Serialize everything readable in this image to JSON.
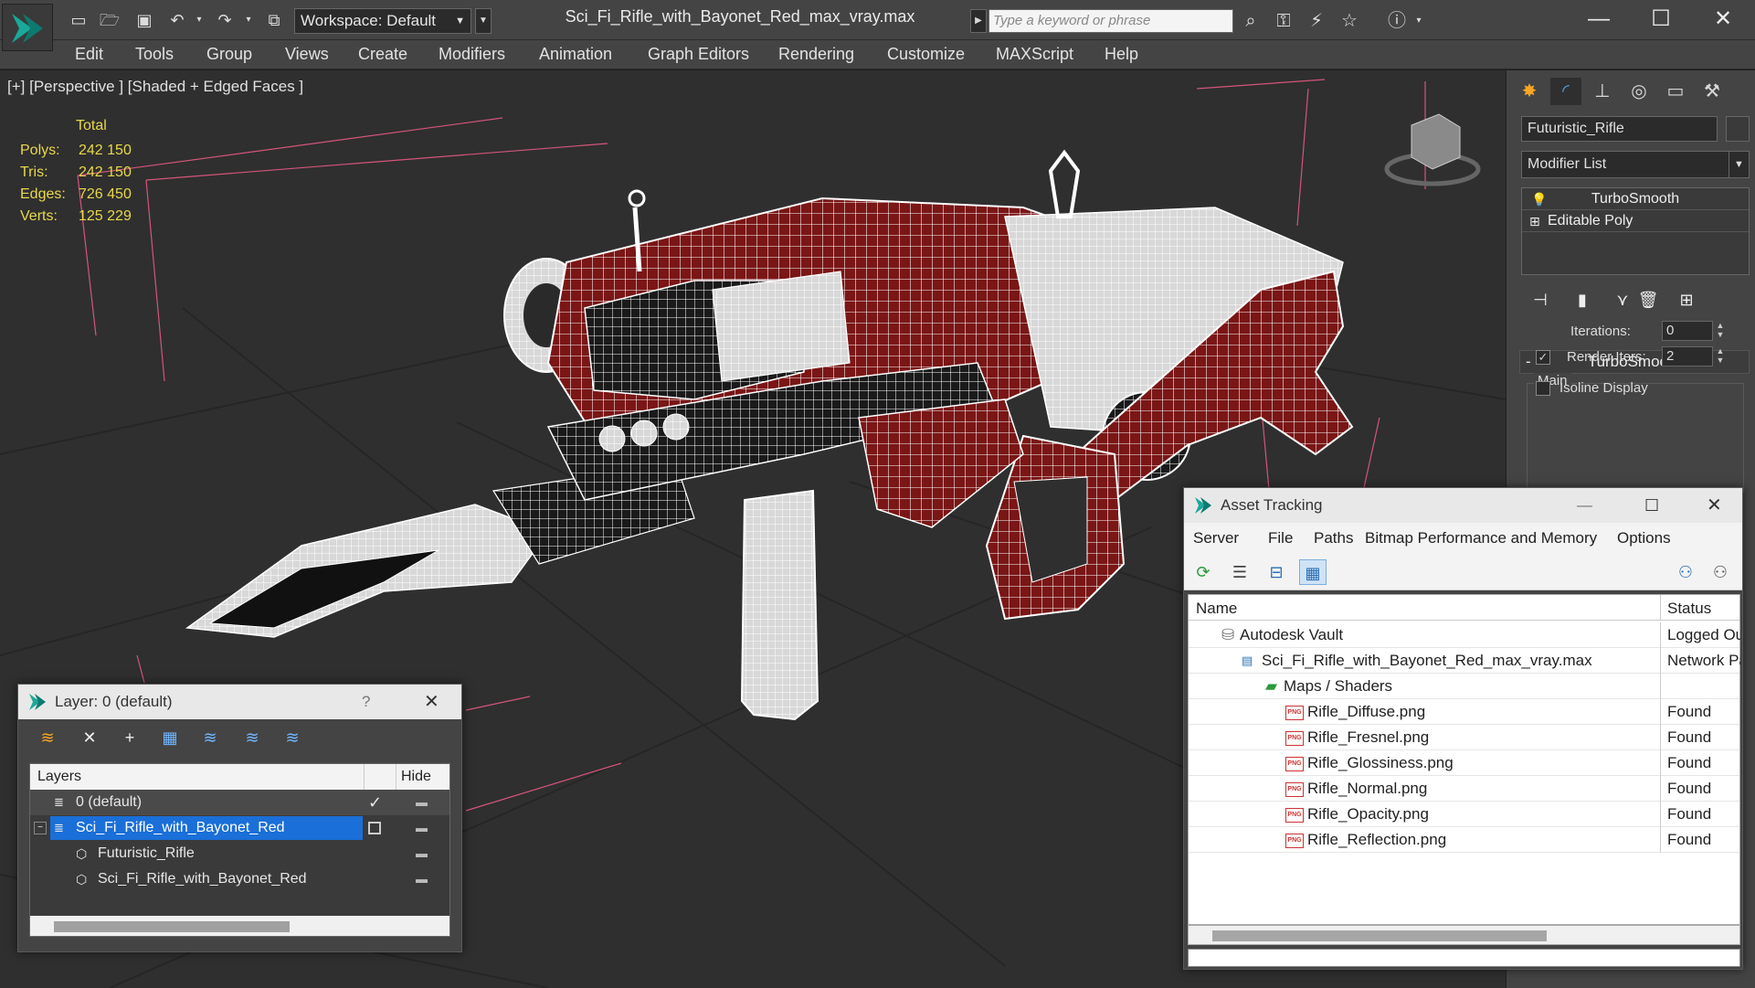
{
  "app": {
    "document_title": "Sci_Fi_Rifle_with_Bayonet_Red_max_vray.max",
    "workspace": "Workspace: Default",
    "search_placeholder": "Type a keyword or phrase"
  },
  "menu": [
    "Edit",
    "Tools",
    "Group",
    "Views",
    "Create",
    "Modifiers",
    "Animation",
    "Graph Editors",
    "Rendering",
    "Customize",
    "MAXScript",
    "Help"
  ],
  "viewport": {
    "label": "[+] [Perspective ] [Shaded + Edged Faces ]",
    "stats": {
      "total_label": "Total",
      "rows": [
        {
          "label": "Polys:",
          "value": "242 150"
        },
        {
          "label": "Tris:",
          "value": "242 150"
        },
        {
          "label": "Edges:",
          "value": "726 450"
        },
        {
          "label": "Verts:",
          "value": "125 229"
        }
      ]
    }
  },
  "command_panel": {
    "object_name": "Futuristic_Rifle",
    "modifier_list": "Modifier List",
    "stack": [
      "TurboSmooth",
      "Editable Poly"
    ],
    "rollout_title": "TurboSmooth",
    "group_main": "Main",
    "iterations_label": "Iterations:",
    "iterations_value": "0",
    "render_iters_label": "Render Iters:",
    "render_iters_value": "2",
    "isoline_label": "Isoline Display"
  },
  "layer_window": {
    "title": "Layer: 0 (default)",
    "help": "?",
    "col_layers": "Layers",
    "col_hide": "Hide",
    "rows": [
      {
        "name": "0 (default)",
        "indent": 1
      },
      {
        "name": "Sci_Fi_Rifle_with_Bayonet_Red",
        "indent": 1
      },
      {
        "name": "Futuristic_Rifle",
        "indent": 2
      },
      {
        "name": "Sci_Fi_Rifle_with_Bayonet_Red",
        "indent": 2
      }
    ]
  },
  "asset_window": {
    "title": "Asset Tracking",
    "menu": [
      "Server",
      "File",
      "Paths",
      "Bitmap Performance and Memory",
      "Options"
    ],
    "col_name": "Name",
    "col_status": "Status",
    "rows": [
      {
        "name": "Autodesk Vault",
        "status": "Logged Out",
        "level": 0
      },
      {
        "name": "Sci_Fi_Rifle_with_Bayonet_Red_max_vray.max",
        "status": "Network Path",
        "level": 1
      },
      {
        "name": "Maps / Shaders",
        "status": "",
        "level": 2
      },
      {
        "name": "Rifle_Diffuse.png",
        "status": "Found",
        "level": 3
      },
      {
        "name": "Rifle_Fresnel.png",
        "status": "Found",
        "level": 3
      },
      {
        "name": "Rifle_Glossiness.png",
        "status": "Found",
        "level": 3
      },
      {
        "name": "Rifle_Normal.png",
        "status": "Found",
        "level": 3
      },
      {
        "name": "Rifle_Opacity.png",
        "status": "Found",
        "level": 3
      },
      {
        "name": "Rifle_Reflection.png",
        "status": "Found",
        "level": 3
      }
    ]
  },
  "icons": {
    "png_badge": "PNG"
  },
  "colors": {
    "accent_selection": "#1a6fd8",
    "stats_yellow": "#e8d84a",
    "model_red": "#7a1616"
  }
}
